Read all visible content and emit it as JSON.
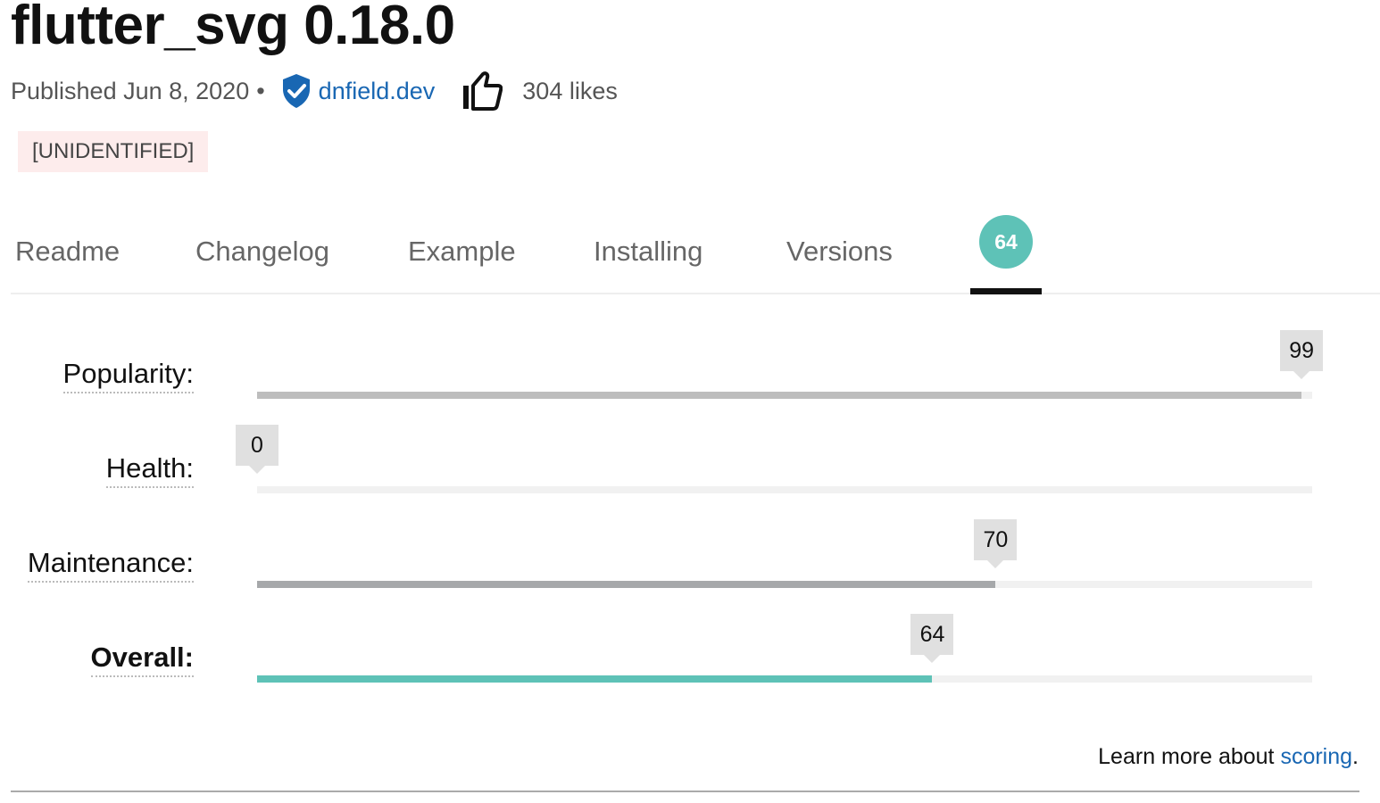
{
  "package": {
    "title": "flutter_svg 0.18.0",
    "published": "Published Jun 8, 2020",
    "separator": "•",
    "publisher": "dnfield.dev",
    "likes": "304 likes",
    "tag": "[UNIDENTIFIED]"
  },
  "tabs": [
    {
      "label": "Readme"
    },
    {
      "label": "Changelog"
    },
    {
      "label": "Example"
    },
    {
      "label": "Installing"
    },
    {
      "label": "Versions"
    }
  ],
  "score_tab": {
    "value": "64",
    "selected": true
  },
  "metrics": [
    {
      "label": "Popularity:",
      "value": 99,
      "display": "99",
      "color": "#bdbdbd",
      "bold": false
    },
    {
      "label": "Health:",
      "value": 0,
      "display": "0",
      "color": "#bdbdbd",
      "bold": false
    },
    {
      "label": "Maintenance:",
      "value": 70,
      "display": "70",
      "color": "#a6a8aa",
      "bold": false
    },
    {
      "label": "Overall:",
      "value": 64,
      "display": "64",
      "color": "#5ec2b7",
      "bold": true
    }
  ],
  "learn_more": {
    "prefix": "Learn more about ",
    "link": "scoring",
    "suffix": "."
  },
  "colors": {
    "accent": "#5ec2b7",
    "link": "#1967b3",
    "tag_bg": "#fdecec"
  },
  "icons": {
    "verified": "verified-shield-icon",
    "likes": "thumb-up-icon"
  }
}
